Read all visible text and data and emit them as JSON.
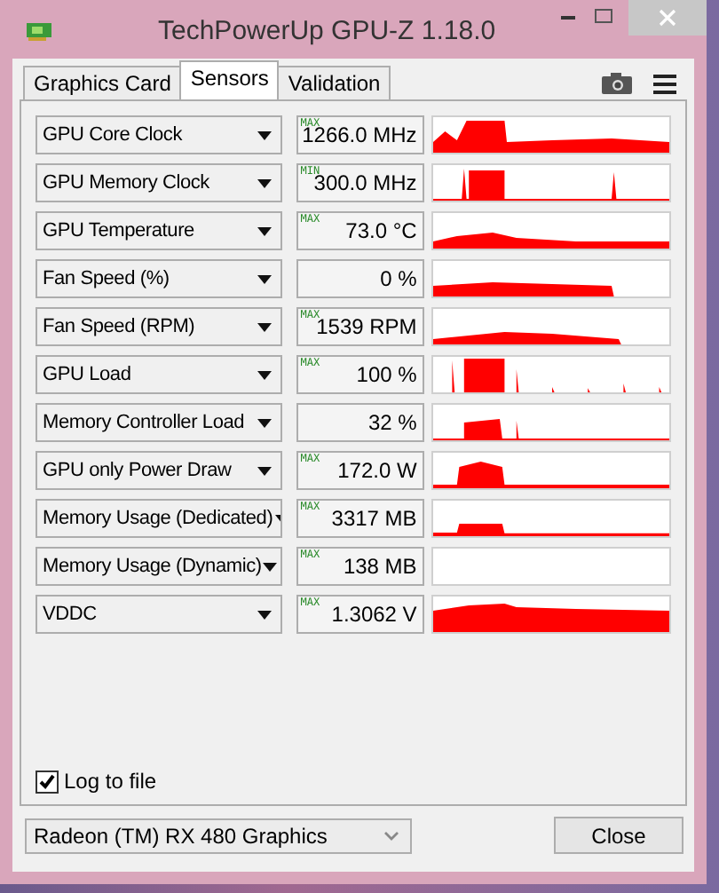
{
  "window": {
    "title": "TechPowerUp GPU-Z 1.18.0"
  },
  "tabs": [
    {
      "label": "Graphics Card",
      "selected": false
    },
    {
      "label": "Sensors",
      "selected": true
    },
    {
      "label": "Validation",
      "selected": false
    }
  ],
  "sensors": [
    {
      "name": "GPU Core Clock",
      "tag": "MAX",
      "value": "1266.0 MHz"
    },
    {
      "name": "GPU Memory Clock",
      "tag": "MIN",
      "value": "300.0 MHz"
    },
    {
      "name": "GPU Temperature",
      "tag": "MAX",
      "value": "73.0 °C"
    },
    {
      "name": "Fan Speed (%)",
      "value": "0 %"
    },
    {
      "name": "Fan Speed (RPM)",
      "tag": "MAX",
      "value": "1539 RPM"
    },
    {
      "name": "GPU Load",
      "tag": "MAX",
      "value": "100 %"
    },
    {
      "name": "Memory Controller Load",
      "value": "32 %"
    },
    {
      "name": "GPU only Power Draw",
      "tag": "MAX",
      "value": "172.0 W"
    },
    {
      "name": "Memory Usage (Dedicated)",
      "tag": "MAX",
      "value": "3317 MB"
    },
    {
      "name": "Memory Usage (Dynamic)",
      "tag": "MAX",
      "value": "138 MB"
    },
    {
      "name": "VDDC",
      "tag": "MAX",
      "value": "1.3062 V"
    }
  ],
  "log_to_file": {
    "label": "Log to file",
    "checked": true
  },
  "device_select": {
    "value": "Radeon (TM) RX 480 Graphics"
  },
  "buttons": [
    "Close"
  ]
}
